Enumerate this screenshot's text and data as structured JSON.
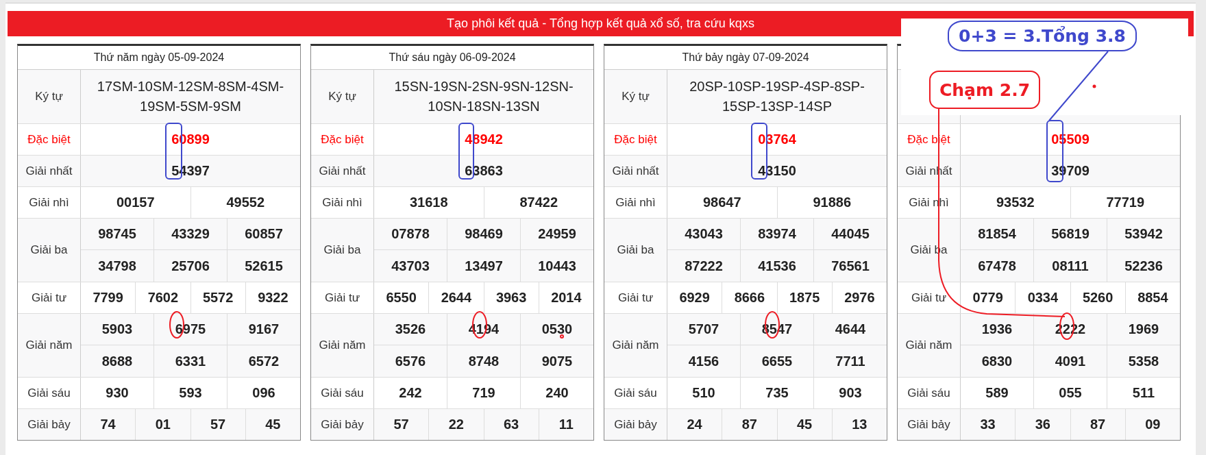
{
  "banner": {
    "title": "Tạo phôi kết quả - Tổng hợp kết quả xổ số, tra cứu kqxs"
  },
  "tables": [
    {
      "date": "Thứ năm ngày 05-09-2024",
      "code_label": "Ký tự",
      "code": "17SM-10SM-12SM-8SM-4SM-19SM-5SM-9SM",
      "prizes": [
        {
          "label": "Đặc biệt",
          "kind": "special",
          "values": [
            "60899"
          ]
        },
        {
          "label": "Giải nhất",
          "kind": "normal",
          "values": [
            "54397"
          ]
        },
        {
          "label": "Giải nhì",
          "kind": "normal",
          "values": [
            "00157",
            "49552"
          ]
        },
        {
          "label": "Giải ba",
          "kind": "normal",
          "values": [
            "98745",
            "43329",
            "60857",
            "34798",
            "25706",
            "52615"
          ]
        },
        {
          "label": "Giải tư",
          "kind": "normal",
          "values": [
            "7799",
            "7602",
            "5572",
            "9322"
          ]
        },
        {
          "label": "Giải năm",
          "kind": "normal",
          "values": [
            "5903",
            "6975",
            "9167",
            "8688",
            "6331",
            "6572"
          ]
        },
        {
          "label": "Giải sáu",
          "kind": "normal",
          "values": [
            "930",
            "593",
            "096"
          ]
        },
        {
          "label": "Giải bảy",
          "kind": "normal",
          "values": [
            "74",
            "01",
            "57",
            "45"
          ]
        }
      ]
    },
    {
      "date": "Thứ sáu ngày 06-09-2024",
      "code_label": "Ký tự",
      "code": "15SN-19SN-2SN-9SN-12SN-10SN-18SN-13SN",
      "prizes": [
        {
          "label": "Đặc biệt",
          "kind": "special",
          "values": [
            "48942"
          ]
        },
        {
          "label": "Giải nhất",
          "kind": "normal",
          "values": [
            "63863"
          ]
        },
        {
          "label": "Giải nhì",
          "kind": "normal",
          "values": [
            "31618",
            "87422"
          ]
        },
        {
          "label": "Giải ba",
          "kind": "normal",
          "values": [
            "07878",
            "98469",
            "24959",
            "43703",
            "13497",
            "10443"
          ]
        },
        {
          "label": "Giải tư",
          "kind": "normal",
          "values": [
            "6550",
            "2644",
            "3963",
            "2014"
          ]
        },
        {
          "label": "Giải năm",
          "kind": "normal",
          "values": [
            "3526",
            "4194",
            "0530",
            "6576",
            "8748",
            "9075"
          ]
        },
        {
          "label": "Giải sáu",
          "kind": "normal",
          "values": [
            "242",
            "719",
            "240"
          ]
        },
        {
          "label": "Giải bảy",
          "kind": "normal",
          "values": [
            "57",
            "22",
            "63",
            "11"
          ]
        }
      ]
    },
    {
      "date": "Thứ bảy ngày 07-09-2024",
      "code_label": "Ký tự",
      "code": "20SP-10SP-19SP-4SP-8SP-15SP-13SP-14SP",
      "prizes": [
        {
          "label": "Đặc biệt",
          "kind": "special",
          "values": [
            "03764"
          ]
        },
        {
          "label": "Giải nhất",
          "kind": "normal",
          "values": [
            "43150"
          ]
        },
        {
          "label": "Giải nhì",
          "kind": "normal",
          "values": [
            "98647",
            "91886"
          ]
        },
        {
          "label": "Giải ba",
          "kind": "normal",
          "values": [
            "43043",
            "83974",
            "44045",
            "87222",
            "41536",
            "76561"
          ]
        },
        {
          "label": "Giải tư",
          "kind": "normal",
          "values": [
            "6929",
            "8666",
            "1875",
            "2976"
          ]
        },
        {
          "label": "Giải năm",
          "kind": "normal",
          "values": [
            "5707",
            "8547",
            "4644",
            "4156",
            "6655",
            "7711"
          ]
        },
        {
          "label": "Giải sáu",
          "kind": "normal",
          "values": [
            "510",
            "735",
            "903"
          ]
        },
        {
          "label": "Giải bảy",
          "kind": "normal",
          "values": [
            "24",
            "87",
            "45",
            "13"
          ]
        }
      ]
    },
    {
      "prizes": [
        {
          "label": "Đặc biệt",
          "kind": "special",
          "values": [
            "05509"
          ]
        },
        {
          "label": "Giải nhất",
          "kind": "normal",
          "values": [
            "39709"
          ]
        },
        {
          "label": "Giải nhì",
          "kind": "normal",
          "values": [
            "93532",
            "77719"
          ]
        },
        {
          "label": "Giải ba",
          "kind": "normal",
          "values": [
            "81854",
            "56819",
            "53942",
            "67478",
            "08111",
            "52236"
          ]
        },
        {
          "label": "Giải tư",
          "kind": "normal",
          "values": [
            "0779",
            "0334",
            "5260",
            "8854"
          ]
        },
        {
          "label": "Giải năm",
          "kind": "normal",
          "values": [
            "1936",
            "2222",
            "1969",
            "6830",
            "4091",
            "5358"
          ]
        },
        {
          "label": "Giải sáu",
          "kind": "normal",
          "values": [
            "589",
            "055",
            "511"
          ]
        },
        {
          "label": "Giải bảy",
          "kind": "normal",
          "values": [
            "33",
            "36",
            "87",
            "09"
          ]
        }
      ]
    }
  ],
  "annotations": {
    "sum_note": "0+3 = 3.Tổng 3.8",
    "touch_note": "Chạm 2.7"
  }
}
